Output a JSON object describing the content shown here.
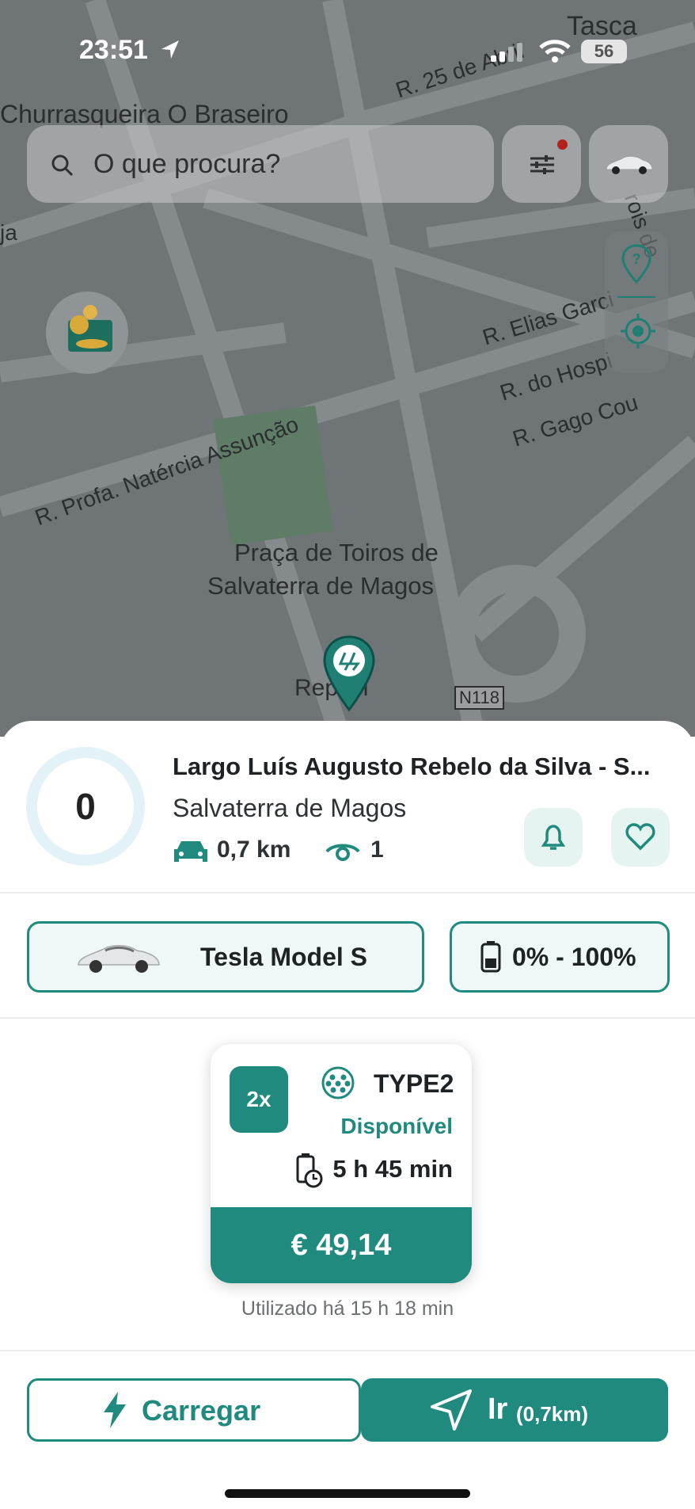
{
  "status_bar": {
    "time": "23:51",
    "battery": "56"
  },
  "map": {
    "labels": {
      "tasca": "Tasca",
      "churrasqueira": "Churrasqueira O Braseiro",
      "rua_25_abril": "R. 25 de Abril",
      "rua_elias": "R. Elias Garci",
      "rua_hospital": "R. do Hospi",
      "rua_gago": "R. Gago Cou",
      "rua_profa": "R. Profa. Natércia Assunção",
      "praca_line1": "Praça de Toiros de",
      "praca_line2": "Salvaterra de Magos",
      "repsol": "Repsol",
      "road_code": "N118",
      "rois": "rois de",
      "ja": "ja"
    }
  },
  "search": {
    "placeholder": "O que procura?"
  },
  "station": {
    "rating_value": "0",
    "name": "Largo Luís Augusto Rebelo da Silva - S...",
    "city": "Salvaterra de Magos",
    "distance": "0,7 km",
    "views": "1"
  },
  "vehicle": {
    "label": "Tesla Model S"
  },
  "battery_range": {
    "label": "0% - 100%"
  },
  "connector": {
    "quantity": "2x",
    "type": "TYPE2",
    "status": "Disponível",
    "charge_time": "5 h 45 min",
    "price": "€ 49,14"
  },
  "last_used": "Utilizado há 15 h 18 min",
  "actions": {
    "charge_label": "Carregar",
    "go_label": "Ir",
    "go_distance": "(0,7km)"
  },
  "colors": {
    "accent": "#1f8a7d",
    "accent_light": "#e6f4f1",
    "alert_dot": "#b3211b"
  },
  "icons": [
    "location-arrow-icon",
    "signal-icon",
    "wifi-icon",
    "search-icon",
    "filter-icon",
    "car-icon",
    "help-pin-icon",
    "crosshair-icon",
    "coins-icon",
    "charger-pin-icon",
    "car-front-icon",
    "eye-icon",
    "bell-icon",
    "heart-icon",
    "battery-icon",
    "plug-type2-icon",
    "charge-time-icon",
    "lightning-icon",
    "navigate-icon"
  ]
}
